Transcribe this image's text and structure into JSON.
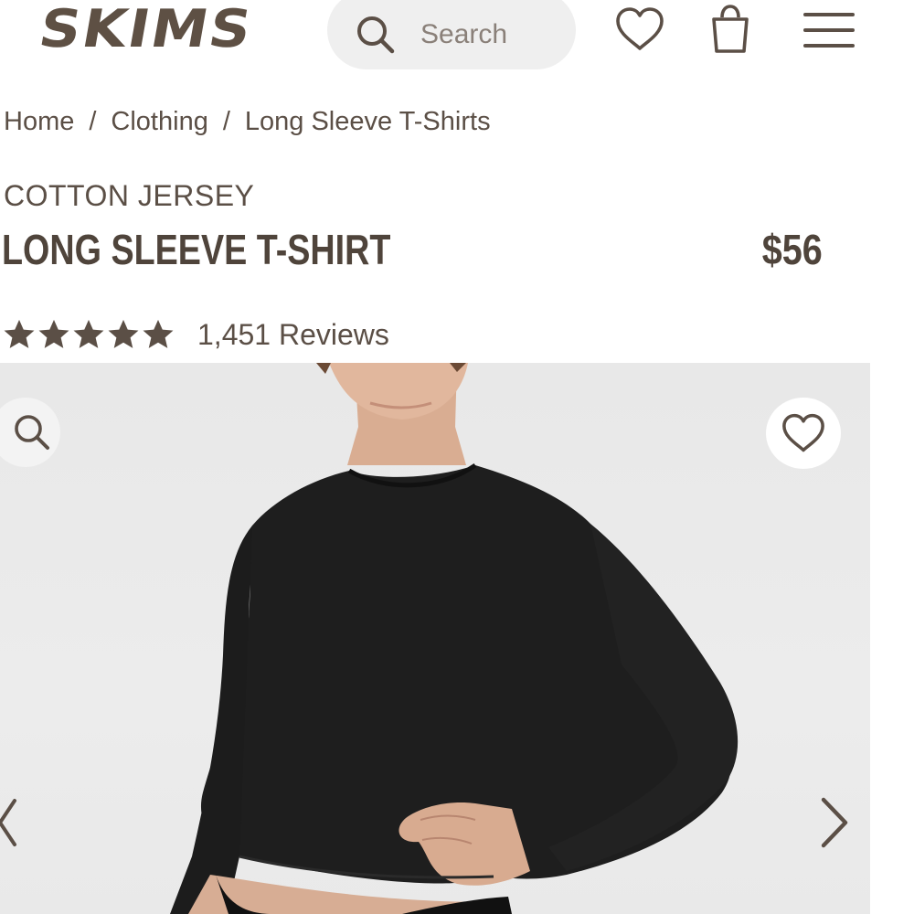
{
  "header": {
    "logo_text": "SKIMS",
    "search_placeholder": "Search",
    "icons": [
      "search-icon",
      "heart-icon",
      "shopping-bag-icon",
      "menu-icon"
    ]
  },
  "breadcrumb": {
    "items": [
      "Home",
      "Clothing",
      "Long Sleeve T-Shirts"
    ],
    "separator": "/"
  },
  "product": {
    "collection": "COTTON JERSEY",
    "name": "LONG SLEEVE T-SHIRT",
    "price": "$56",
    "rating": {
      "stars": 5,
      "reviews_label": "1,451 Reviews"
    }
  },
  "gallery": {
    "icons": [
      "zoom-icon",
      "wishlist-heart-icon",
      "chevron-left-icon",
      "chevron-right-icon"
    ]
  },
  "colors": {
    "brand": "#5e5044",
    "text": "#5b4f46",
    "search_bg": "#efefef",
    "gallery_bg": "#e9e9e9",
    "garment": "#1c1c1c"
  }
}
